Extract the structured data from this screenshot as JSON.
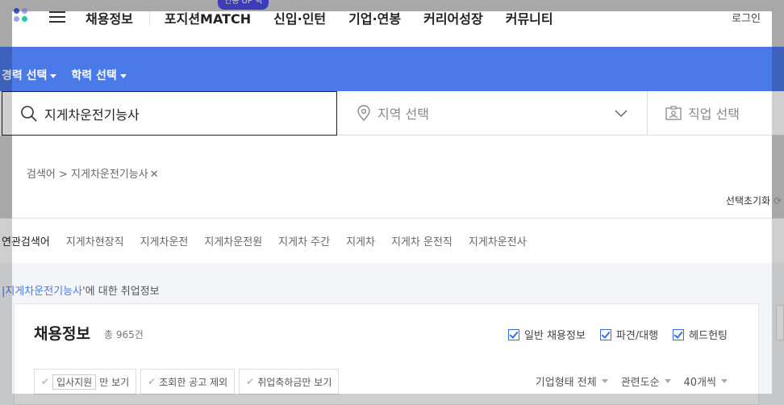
{
  "header": {
    "badge": "연봉 UP 픽",
    "nav": [
      "채용정보",
      "포지션MATCH",
      "신입·인턴",
      "기업·연봉",
      "커리어성장",
      "커뮤니티"
    ],
    "login": "로그인"
  },
  "filters": [
    "경력 선택",
    "학력 선택"
  ],
  "search": {
    "keyword": "지게차운전기능사",
    "region_placeholder": "지역 선택",
    "job_placeholder": "직업 선택"
  },
  "breadcrumb": {
    "label": "검색어 > 지게차운전기능사",
    "reset": "선택초기화"
  },
  "related": {
    "label": "연관검색어",
    "keywords": [
      "지게차현장직",
      "지게차운전",
      "지게차운전원",
      "지게차 주간",
      "지게차",
      "지게차 운전직",
      "지게차운전사"
    ]
  },
  "results": {
    "about_keyword": "지게차운전기능사",
    "about_suffix": "'에 대한 취업정보",
    "title": "채용정보",
    "count": "총 965건",
    "checks": [
      "일반 채용정보",
      "파견/대행",
      "헤드헌팅"
    ],
    "toggles": [
      {
        "tag": "입사지원",
        "label": "만 보기"
      },
      {
        "tag": "",
        "label": "조회한 공고 제외"
      },
      {
        "tag": "",
        "label": "취업축하금만 보기"
      }
    ],
    "sorts": [
      "기업형태 전체",
      "관련도순",
      "40개씩"
    ]
  },
  "colors": {
    "accent": "#4a79e8",
    "badge": "#4a4ae0"
  }
}
